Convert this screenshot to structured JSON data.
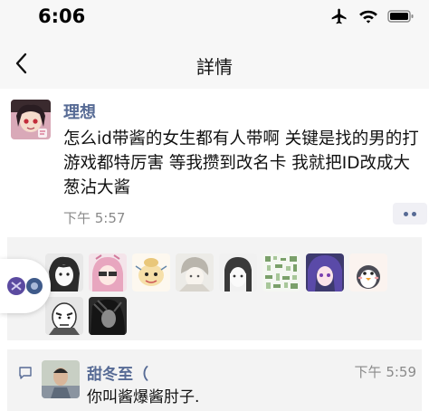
{
  "status_bar": {
    "time": "6:06",
    "icons": [
      "airplane-icon",
      "wifi-icon",
      "battery-icon"
    ]
  },
  "nav": {
    "title": "詳情",
    "back_icon": "chevron-left-icon"
  },
  "post": {
    "username": "理想",
    "text": "怎么id带酱的女生都有人带啊 关键是找的男的打游戏都特厉害 等我攒到改名卡 我就把ID改成大葱沾大酱",
    "time": "下午 5:57",
    "more_icon": "more-dots-icon"
  },
  "likes": {
    "avatars": [
      "anime-girl-avatar",
      "pink-hair-avatar",
      "cartoon-sticker-avatar",
      "sketch-boy-avatar",
      "anime-sketch-avatar",
      "qr-pattern-avatar",
      "purple-hair-avatar",
      "penguin-avatar",
      "bald-character-avatar",
      "dark-anime-avatar"
    ]
  },
  "comment": {
    "author": "甜冬至（",
    "time": "下午 5:59",
    "text": "你叫酱爆酱肘子.",
    "icon": "comment-bubble-icon"
  },
  "colors": {
    "link": "#576b95",
    "page_bg": "#f7f7f7",
    "card_bg": "#ffffff",
    "likes_bg": "#f3f3f3",
    "meta_text": "#8a8a8a"
  }
}
